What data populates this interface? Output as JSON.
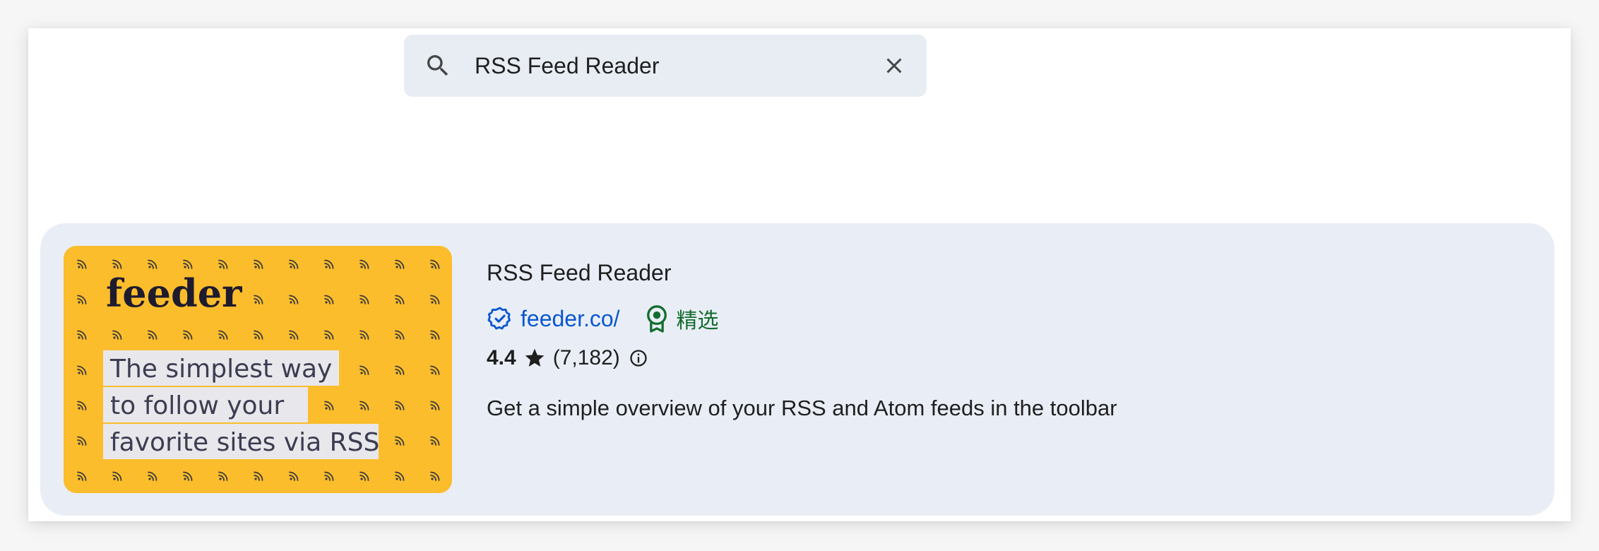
{
  "search": {
    "value": "RSS Feed Reader",
    "icon": "search-icon",
    "clear_icon": "close-icon"
  },
  "result": {
    "title": "RSS Feed Reader",
    "publisher": "feeder.co/",
    "publisher_verified_icon": "verified-badge-icon",
    "featured_label": "精选",
    "featured_icon": "featured-badge-icon",
    "rating": "4.4",
    "rating_count": "(7,182)",
    "description": "Get a simple overview of your RSS and Atom feeds in the toolbar",
    "thumbnail": {
      "brand": "feeder",
      "tagline_lines": [
        "The simplest way",
        "to follow your",
        "favorite sites via RSS"
      ],
      "background_color": "#fbbd2c",
      "pattern_icon": "rss-icon"
    }
  },
  "colors": {
    "accent_link": "#0b57d0",
    "featured_green": "#146c2e",
    "card_bg": "#e9eef6",
    "search_bg": "#e8edf4"
  }
}
